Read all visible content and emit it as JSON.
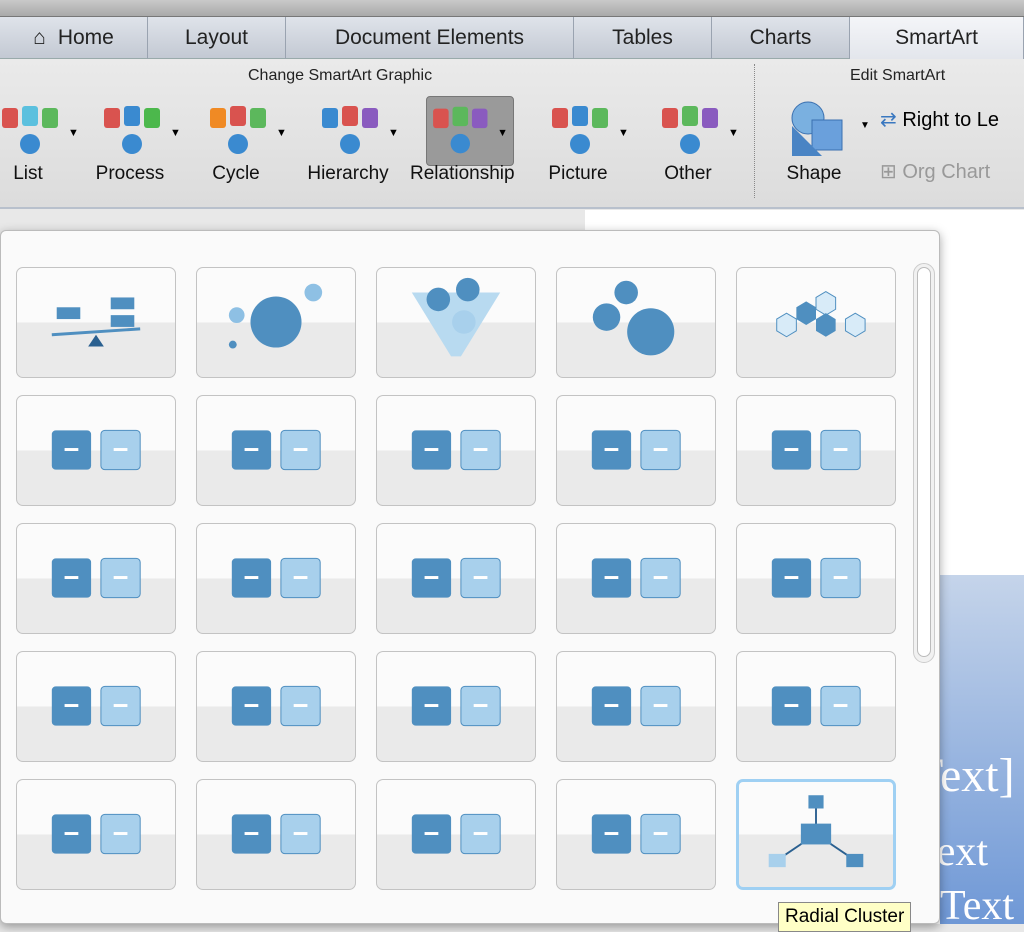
{
  "tabs": [
    {
      "label": "Home",
      "icon": "home-icon"
    },
    {
      "label": "Layout"
    },
    {
      "label": "Document Elements"
    },
    {
      "label": "Tables"
    },
    {
      "label": "Charts"
    },
    {
      "label": "SmartArt",
      "active": true
    }
  ],
  "ribbon": {
    "change_group": "Change SmartArt Graphic",
    "edit_group": "Edit SmartArt",
    "buttons": [
      {
        "label": "List"
      },
      {
        "label": "Process"
      },
      {
        "label": "Cycle"
      },
      {
        "label": "Hierarchy"
      },
      {
        "label": "Relationship",
        "selected": true
      },
      {
        "label": "Picture"
      },
      {
        "label": "Other"
      }
    ],
    "shape": "Shape",
    "right_to_left": "Right to Le",
    "org_chart": "Org Chart"
  },
  "gallery": {
    "selected_index": 24,
    "tooltip": "Radial Cluster",
    "tile_color": "#4f8fc0"
  },
  "document": {
    "text1": "[Text]",
    "text2": "[Text",
    "text3": "Text"
  },
  "colors": {
    "accent": "#4f8fc0",
    "selection": "#9fd0f3"
  }
}
